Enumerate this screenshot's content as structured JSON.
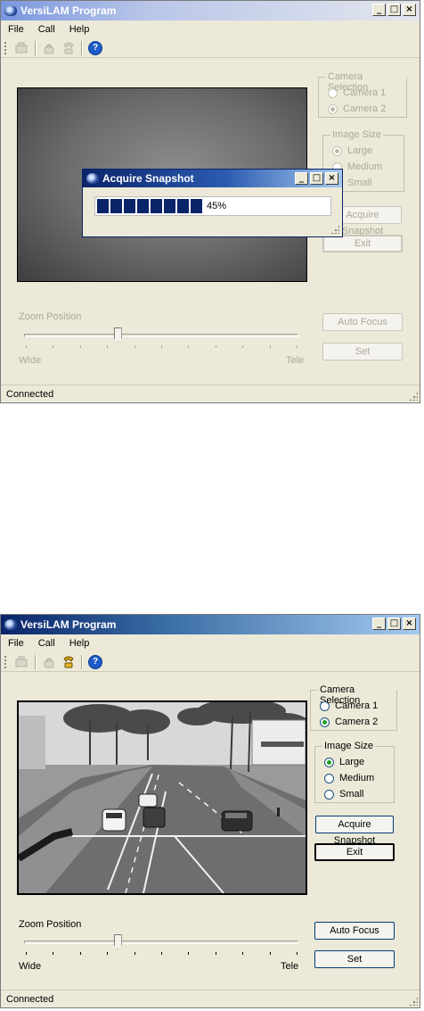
{
  "windows": [
    {
      "title": "VersiLAM Program",
      "title_buttons": [
        "_",
        "□",
        "×"
      ],
      "menu": [
        "File",
        "Call",
        "Help"
      ],
      "toolbar": [
        "camera-icon",
        "phone-icon",
        "hangup-icon",
        "help-icon"
      ],
      "camera_selection": {
        "legend": "Camera Selection",
        "options": [
          "Camera 1",
          "Camera 2"
        ],
        "selected": "Camera 2"
      },
      "image_size": {
        "legend": "Image Size",
        "options": [
          "Large",
          "Medium",
          "Small"
        ],
        "selected": "Large"
      },
      "buttons": {
        "acquire": "Acquire Snapshot",
        "exit": "Exit",
        "auto_focus": "Auto Focus",
        "set": "Set"
      },
      "zoom": {
        "label": "Zoom Position",
        "wide": "Wide",
        "tele": "Tele",
        "position": 0.34
      },
      "status": "Connected",
      "dialog": {
        "title": "Acquire Snapshot",
        "progress_text": "45%",
        "progress": 0.45
      }
    },
    {
      "title": "VersiLAM Program",
      "title_buttons": [
        "_",
        "□",
        "×"
      ],
      "menu": [
        "File",
        "Call",
        "Help"
      ],
      "toolbar": [
        "camera-icon",
        "phone-icon",
        "hangup-icon",
        "help-icon"
      ],
      "camera_selection": {
        "legend": "Camera Selection",
        "options": [
          "Camera 1",
          "Camera 2"
        ],
        "selected": "Camera 2"
      },
      "image_size": {
        "legend": "Image Size",
        "options": [
          "Large",
          "Medium",
          "Small"
        ],
        "selected": "Large"
      },
      "buttons": {
        "acquire": "Acquire Snapshot",
        "exit": "Exit",
        "auto_focus": "Auto Focus",
        "set": "Set"
      },
      "zoom": {
        "label": "Zoom Position",
        "wide": "Wide",
        "tele": "Tele",
        "position": 0.34
      },
      "status": "Connected"
    }
  ],
  "colors": {
    "title_active": "#0a246a",
    "progress_fill": "#0a246a",
    "face": "#ece9d8"
  }
}
